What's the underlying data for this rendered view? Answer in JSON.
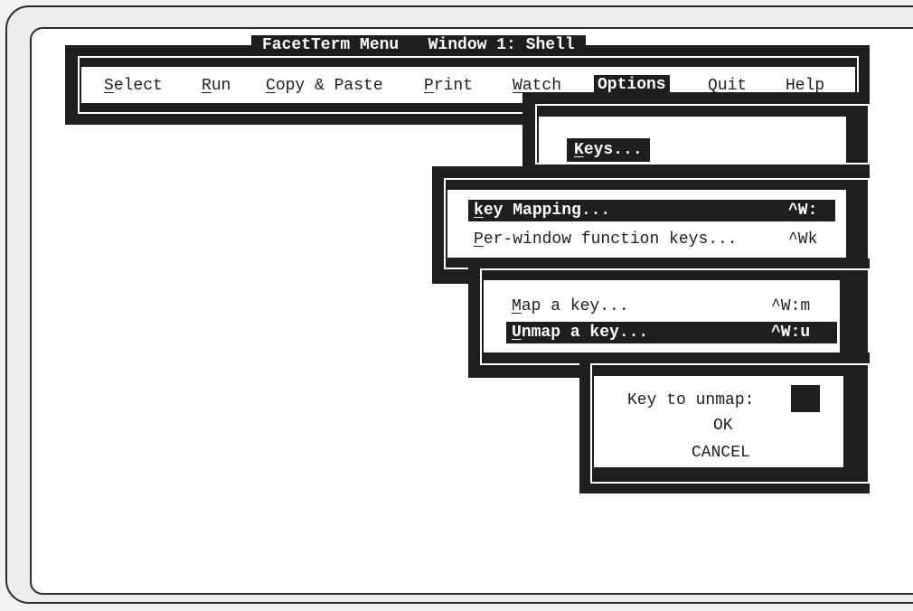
{
  "title_bar": "FacetTerm Menu   Window 1: Shell",
  "menu": [
    {
      "hot": "S",
      "rest": "elect"
    },
    {
      "hot": "R",
      "rest": "un"
    },
    {
      "hot": "C",
      "rest": "opy & Paste"
    },
    {
      "hot": "P",
      "rest": "rint"
    },
    {
      "hot": "W",
      "rest": "atch"
    },
    {
      "hot": "",
      "rest": "Options"
    },
    {
      "hot": "",
      "rest": "Quit"
    },
    {
      "hot": "",
      "rest": "Help"
    }
  ],
  "options_menu": {
    "hot": "K",
    "rest": "eys..."
  },
  "keys_menu": [
    {
      "hot": "k",
      "rest": "ey Mapping...",
      "shortcut": "^W:"
    },
    {
      "hot": "P",
      "rest": "er-window function keys...",
      "shortcut": "^Wk"
    }
  ],
  "mapping_menu": [
    {
      "hot": "M",
      "rest": "ap a key...",
      "shortcut": "^W:m"
    },
    {
      "hot": "U",
      "rest": "nmap a key...",
      "shortcut": "^W:u"
    }
  ],
  "dialog": {
    "prompt": "Key to unmap:",
    "ok": "OK",
    "cancel": "CANCEL"
  }
}
